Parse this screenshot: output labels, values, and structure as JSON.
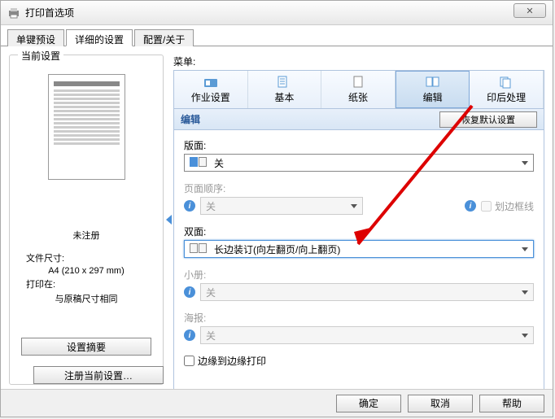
{
  "window": {
    "title": "打印首选项"
  },
  "tabs": [
    "单键预设",
    "详细的设置",
    "配置/关于"
  ],
  "left": {
    "legend": "当前设置",
    "unregistered": "未注册",
    "file_size_label": "文件尺寸:",
    "file_size_value": "A4 (210 x 297 mm)",
    "print_at_label": "打印在:",
    "print_at_value": "与原稿尺寸相同",
    "summary_btn": "设置摘要",
    "register_btn": "注册当前设置…"
  },
  "menu": {
    "label": "菜单:",
    "items": [
      "作业设置",
      "基本",
      "纸张",
      "编辑",
      "印后处理"
    ]
  },
  "section": {
    "title": "编辑",
    "restore_btn": "恢复默认设置"
  },
  "fields": {
    "layout": {
      "label": "版面:",
      "value": "关"
    },
    "page_order": {
      "label": "页面顺序:",
      "value": "关"
    },
    "borders": {
      "label": "划边框线"
    },
    "duplex": {
      "label": "双面:",
      "value": "长边装订(向左翻页/向上翻页)"
    },
    "booklet": {
      "label": "小册:",
      "value": "关"
    },
    "poster": {
      "label": "海报:",
      "value": "关"
    },
    "edge_to_edge": {
      "label": "边缘到边缘打印"
    }
  },
  "footer": {
    "ok": "确定",
    "cancel": "取消",
    "help": "帮助"
  }
}
